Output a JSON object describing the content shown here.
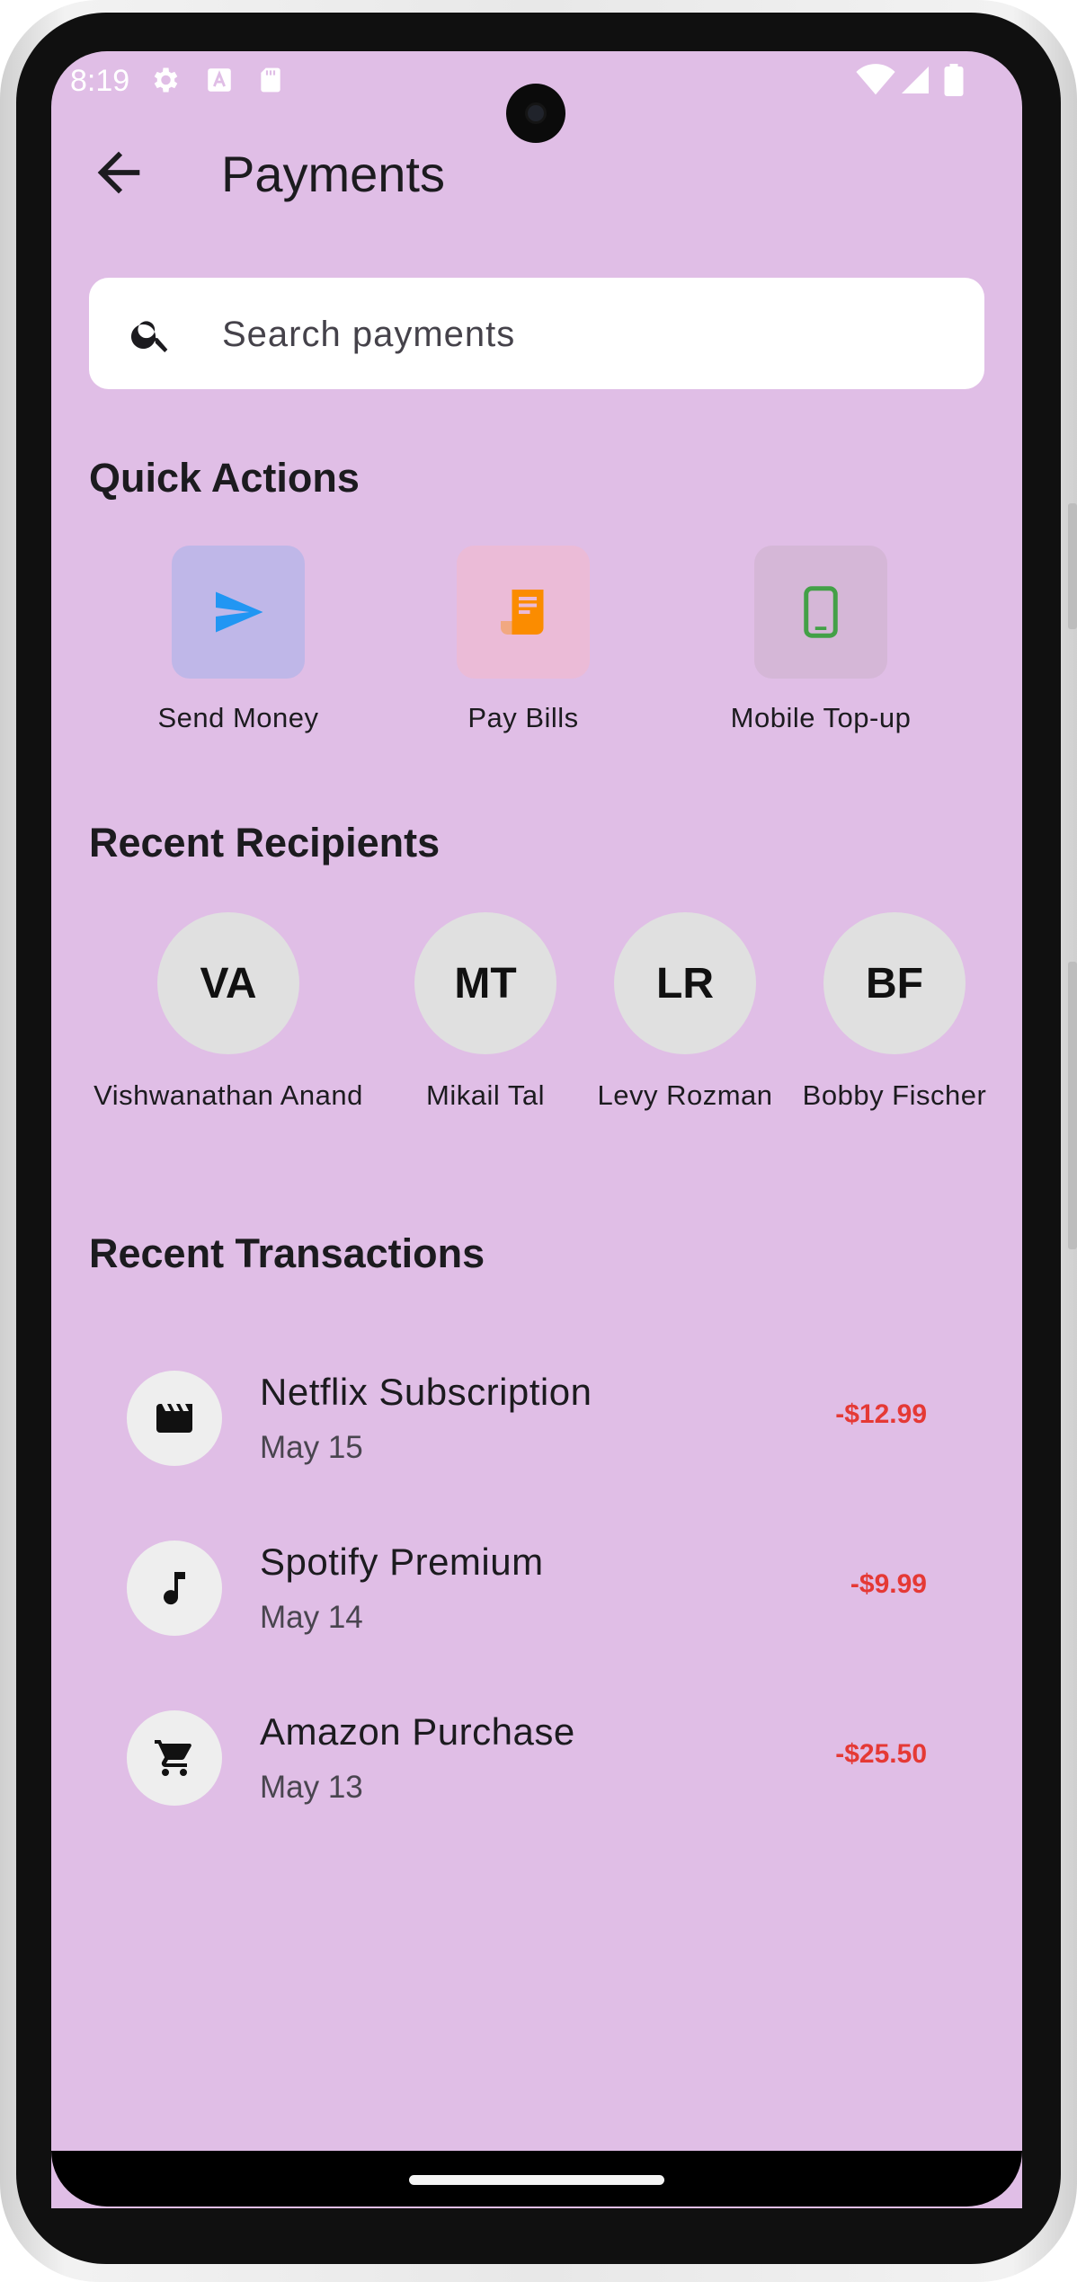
{
  "status_bar": {
    "time": "8:19",
    "icons": [
      "gear-icon",
      "text-a-icon",
      "sd-card-icon",
      "wifi-icon",
      "signal-icon",
      "battery-icon"
    ]
  },
  "header": {
    "back_icon": "arrow-back-icon",
    "title": "Payments"
  },
  "search": {
    "placeholder": "Search payments",
    "value": "",
    "icon": "search-icon"
  },
  "quick_actions": {
    "title": "Quick Actions",
    "items": [
      {
        "label": "Send Money",
        "icon": "send-icon",
        "tile_color": "#bfb7e8",
        "icon_color": "#2196f3"
      },
      {
        "label": "Pay Bills",
        "icon": "receipt-icon",
        "tile_color": "#ebbbd7",
        "icon_color": "#fb8c00"
      },
      {
        "label": "Mobile Top-up",
        "icon": "smartphone-icon",
        "tile_color": "#d5b7d7",
        "icon_color": "#43a047"
      }
    ]
  },
  "recent_recipients": {
    "title": "Recent Recipients",
    "items": [
      {
        "initials": "VA",
        "name": "Vishwanathan Anand"
      },
      {
        "initials": "MT",
        "name": "Mikail Tal"
      },
      {
        "initials": "LR",
        "name": "Levy Rozman"
      },
      {
        "initials": "BF",
        "name": "Bobby Fischer"
      }
    ]
  },
  "recent_transactions": {
    "title": "Recent Transactions",
    "items": [
      {
        "name": "Netflix Subscription",
        "date": "May 15",
        "amount": "-$12.99",
        "icon": "movie-icon"
      },
      {
        "name": "Spotify Premium",
        "date": "May 14",
        "amount": "-$9.99",
        "icon": "music-note-icon"
      },
      {
        "name": "Amazon Purchase",
        "date": "May 13",
        "amount": "-$25.50",
        "icon": "shopping-cart-icon"
      }
    ]
  },
  "colors": {
    "background": "#e0bee6",
    "amount_negative": "#e53935",
    "text_primary": "#1c1b1f"
  }
}
